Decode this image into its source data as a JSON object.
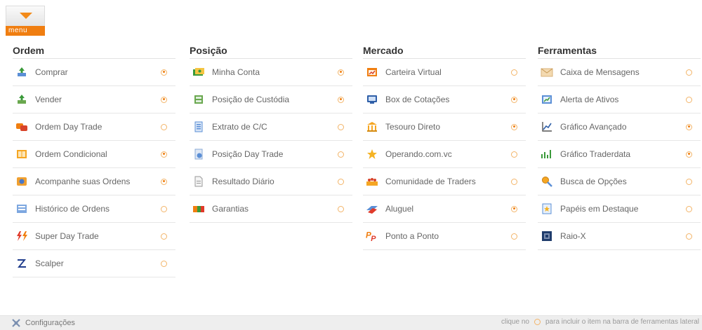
{
  "menu": {
    "label": "menu"
  },
  "columns": [
    {
      "title": "Ordem",
      "items": [
        {
          "label": "Comprar",
          "icon": "buy-icon",
          "selected": true
        },
        {
          "label": "Vender",
          "icon": "sell-icon",
          "selected": true
        },
        {
          "label": "Ordem Day Trade",
          "icon": "day-trade-order-icon",
          "selected": false
        },
        {
          "label": "Ordem Condicional",
          "icon": "conditional-order-icon",
          "selected": true
        },
        {
          "label": "Acompanhe suas Ordens",
          "icon": "track-orders-icon",
          "selected": true
        },
        {
          "label": "Histórico de Ordens",
          "icon": "order-history-icon",
          "selected": false
        },
        {
          "label": "Super Day Trade",
          "icon": "lightning-icon",
          "selected": false
        },
        {
          "label": "Scalper",
          "icon": "scalper-icon",
          "selected": false
        }
      ]
    },
    {
      "title": "Posição",
      "items": [
        {
          "label": "Minha Conta",
          "icon": "account-icon",
          "selected": true
        },
        {
          "label": "Posição de Custódia",
          "icon": "custody-icon",
          "selected": true
        },
        {
          "label": "Extrato de C/C",
          "icon": "statement-icon",
          "selected": false
        },
        {
          "label": "Posição Day Trade",
          "icon": "day-trade-position-icon",
          "selected": false
        },
        {
          "label": "Resultado Diário",
          "icon": "document-icon",
          "selected": false
        },
        {
          "label": "Garantias",
          "icon": "guarantees-icon",
          "selected": false
        }
      ]
    },
    {
      "title": "Mercado",
      "items": [
        {
          "label": "Carteira Virtual",
          "icon": "virtual-wallet-icon",
          "selected": false
        },
        {
          "label": "Box de Cotações",
          "icon": "quotes-box-icon",
          "selected": true
        },
        {
          "label": "Tesouro Direto",
          "icon": "treasury-icon",
          "selected": true
        },
        {
          "label": "Operando.com.vc",
          "icon": "star-icon",
          "selected": false
        },
        {
          "label": "Comunidade de Traders",
          "icon": "community-icon",
          "selected": false
        },
        {
          "label": "Aluguel",
          "icon": "rent-icon",
          "selected": true
        },
        {
          "label": "Ponto a Ponto",
          "icon": "pp-icon",
          "selected": false
        }
      ]
    },
    {
      "title": "Ferramentas",
      "items": [
        {
          "label": "Caixa de Mensagens",
          "icon": "envelope-icon",
          "selected": false
        },
        {
          "label": "Alerta de Ativos",
          "icon": "alert-chart-icon",
          "selected": false
        },
        {
          "label": "Gráfico Avançado",
          "icon": "advanced-chart-icon",
          "selected": true
        },
        {
          "label": "Gráfico Traderdata",
          "icon": "bar-chart-icon",
          "selected": true
        },
        {
          "label": "Busca de Opções",
          "icon": "search-options-icon",
          "selected": false
        },
        {
          "label": "Papéis em Destaque",
          "icon": "highlight-papers-icon",
          "selected": false
        },
        {
          "label": "Raio-X",
          "icon": "xray-icon",
          "selected": false
        }
      ]
    }
  ],
  "footer": {
    "settings_label": "Configurações",
    "hint_before": "clique no",
    "hint_after": "para incluir o item na barra de ferramentas lateral"
  },
  "colors": {
    "accent": "#f07e10",
    "radio_border": "#f3b468"
  }
}
